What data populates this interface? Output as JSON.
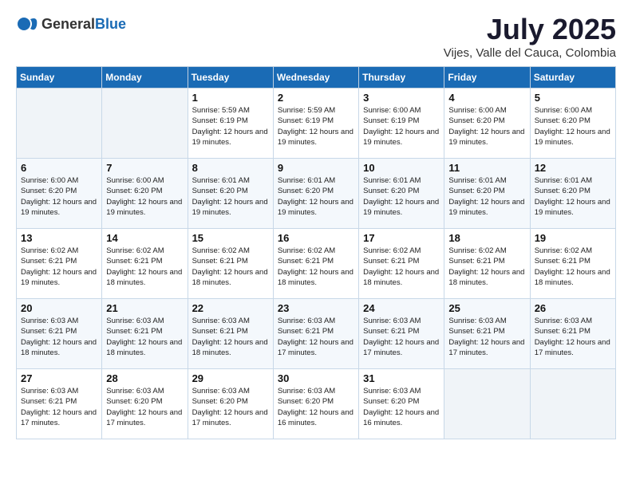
{
  "header": {
    "logo_general": "General",
    "logo_blue": "Blue",
    "month_year": "July 2025",
    "location": "Vijes, Valle del Cauca, Colombia"
  },
  "weekdays": [
    "Sunday",
    "Monday",
    "Tuesday",
    "Wednesday",
    "Thursday",
    "Friday",
    "Saturday"
  ],
  "weeks": [
    [
      {
        "day": "",
        "empty": true
      },
      {
        "day": "",
        "empty": true
      },
      {
        "day": "1",
        "sunrise": "Sunrise: 5:59 AM",
        "sunset": "Sunset: 6:19 PM",
        "daylight": "Daylight: 12 hours and 19 minutes."
      },
      {
        "day": "2",
        "sunrise": "Sunrise: 5:59 AM",
        "sunset": "Sunset: 6:19 PM",
        "daylight": "Daylight: 12 hours and 19 minutes."
      },
      {
        "day": "3",
        "sunrise": "Sunrise: 6:00 AM",
        "sunset": "Sunset: 6:19 PM",
        "daylight": "Daylight: 12 hours and 19 minutes."
      },
      {
        "day": "4",
        "sunrise": "Sunrise: 6:00 AM",
        "sunset": "Sunset: 6:20 PM",
        "daylight": "Daylight: 12 hours and 19 minutes."
      },
      {
        "day": "5",
        "sunrise": "Sunrise: 6:00 AM",
        "sunset": "Sunset: 6:20 PM",
        "daylight": "Daylight: 12 hours and 19 minutes."
      }
    ],
    [
      {
        "day": "6",
        "sunrise": "Sunrise: 6:00 AM",
        "sunset": "Sunset: 6:20 PM",
        "daylight": "Daylight: 12 hours and 19 minutes."
      },
      {
        "day": "7",
        "sunrise": "Sunrise: 6:00 AM",
        "sunset": "Sunset: 6:20 PM",
        "daylight": "Daylight: 12 hours and 19 minutes."
      },
      {
        "day": "8",
        "sunrise": "Sunrise: 6:01 AM",
        "sunset": "Sunset: 6:20 PM",
        "daylight": "Daylight: 12 hours and 19 minutes."
      },
      {
        "day": "9",
        "sunrise": "Sunrise: 6:01 AM",
        "sunset": "Sunset: 6:20 PM",
        "daylight": "Daylight: 12 hours and 19 minutes."
      },
      {
        "day": "10",
        "sunrise": "Sunrise: 6:01 AM",
        "sunset": "Sunset: 6:20 PM",
        "daylight": "Daylight: 12 hours and 19 minutes."
      },
      {
        "day": "11",
        "sunrise": "Sunrise: 6:01 AM",
        "sunset": "Sunset: 6:20 PM",
        "daylight": "Daylight: 12 hours and 19 minutes."
      },
      {
        "day": "12",
        "sunrise": "Sunrise: 6:01 AM",
        "sunset": "Sunset: 6:20 PM",
        "daylight": "Daylight: 12 hours and 19 minutes."
      }
    ],
    [
      {
        "day": "13",
        "sunrise": "Sunrise: 6:02 AM",
        "sunset": "Sunset: 6:21 PM",
        "daylight": "Daylight: 12 hours and 19 minutes."
      },
      {
        "day": "14",
        "sunrise": "Sunrise: 6:02 AM",
        "sunset": "Sunset: 6:21 PM",
        "daylight": "Daylight: 12 hours and 18 minutes."
      },
      {
        "day": "15",
        "sunrise": "Sunrise: 6:02 AM",
        "sunset": "Sunset: 6:21 PM",
        "daylight": "Daylight: 12 hours and 18 minutes."
      },
      {
        "day": "16",
        "sunrise": "Sunrise: 6:02 AM",
        "sunset": "Sunset: 6:21 PM",
        "daylight": "Daylight: 12 hours and 18 minutes."
      },
      {
        "day": "17",
        "sunrise": "Sunrise: 6:02 AM",
        "sunset": "Sunset: 6:21 PM",
        "daylight": "Daylight: 12 hours and 18 minutes."
      },
      {
        "day": "18",
        "sunrise": "Sunrise: 6:02 AM",
        "sunset": "Sunset: 6:21 PM",
        "daylight": "Daylight: 12 hours and 18 minutes."
      },
      {
        "day": "19",
        "sunrise": "Sunrise: 6:02 AM",
        "sunset": "Sunset: 6:21 PM",
        "daylight": "Daylight: 12 hours and 18 minutes."
      }
    ],
    [
      {
        "day": "20",
        "sunrise": "Sunrise: 6:03 AM",
        "sunset": "Sunset: 6:21 PM",
        "daylight": "Daylight: 12 hours and 18 minutes."
      },
      {
        "day": "21",
        "sunrise": "Sunrise: 6:03 AM",
        "sunset": "Sunset: 6:21 PM",
        "daylight": "Daylight: 12 hours and 18 minutes."
      },
      {
        "day": "22",
        "sunrise": "Sunrise: 6:03 AM",
        "sunset": "Sunset: 6:21 PM",
        "daylight": "Daylight: 12 hours and 18 minutes."
      },
      {
        "day": "23",
        "sunrise": "Sunrise: 6:03 AM",
        "sunset": "Sunset: 6:21 PM",
        "daylight": "Daylight: 12 hours and 17 minutes."
      },
      {
        "day": "24",
        "sunrise": "Sunrise: 6:03 AM",
        "sunset": "Sunset: 6:21 PM",
        "daylight": "Daylight: 12 hours and 17 minutes."
      },
      {
        "day": "25",
        "sunrise": "Sunrise: 6:03 AM",
        "sunset": "Sunset: 6:21 PM",
        "daylight": "Daylight: 12 hours and 17 minutes."
      },
      {
        "day": "26",
        "sunrise": "Sunrise: 6:03 AM",
        "sunset": "Sunset: 6:21 PM",
        "daylight": "Daylight: 12 hours and 17 minutes."
      }
    ],
    [
      {
        "day": "27",
        "sunrise": "Sunrise: 6:03 AM",
        "sunset": "Sunset: 6:21 PM",
        "daylight": "Daylight: 12 hours and 17 minutes."
      },
      {
        "day": "28",
        "sunrise": "Sunrise: 6:03 AM",
        "sunset": "Sunset: 6:20 PM",
        "daylight": "Daylight: 12 hours and 17 minutes."
      },
      {
        "day": "29",
        "sunrise": "Sunrise: 6:03 AM",
        "sunset": "Sunset: 6:20 PM",
        "daylight": "Daylight: 12 hours and 17 minutes."
      },
      {
        "day": "30",
        "sunrise": "Sunrise: 6:03 AM",
        "sunset": "Sunset: 6:20 PM",
        "daylight": "Daylight: 12 hours and 16 minutes."
      },
      {
        "day": "31",
        "sunrise": "Sunrise: 6:03 AM",
        "sunset": "Sunset: 6:20 PM",
        "daylight": "Daylight: 12 hours and 16 minutes."
      },
      {
        "day": "",
        "empty": true
      },
      {
        "day": "",
        "empty": true
      }
    ]
  ]
}
